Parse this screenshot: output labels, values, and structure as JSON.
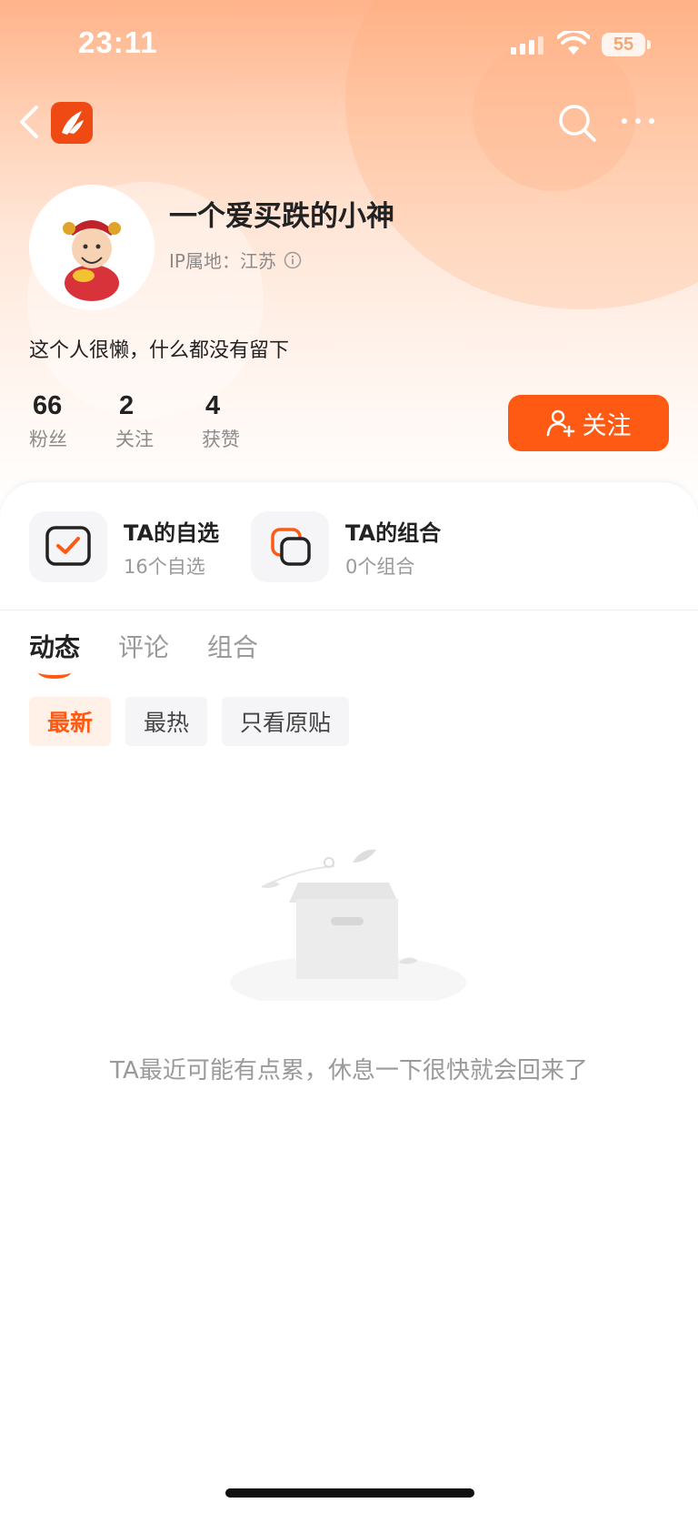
{
  "status_bar": {
    "time": "23:11",
    "battery": "55"
  },
  "profile": {
    "name": "一个爱买跌的小神",
    "ip_label": "IP属地：江苏",
    "bio": "这个人很懒，什么都没有留下",
    "stats": [
      {
        "value": "66",
        "label": "粉丝"
      },
      {
        "value": "2",
        "label": "关注"
      },
      {
        "value": "4",
        "label": "获赞"
      }
    ],
    "follow_label": "关注"
  },
  "portfolio": [
    {
      "title": "TA的自选",
      "sub": "16个自选"
    },
    {
      "title": "TA的组合",
      "sub": "0个组合"
    }
  ],
  "tabs": [
    "动态",
    "评论",
    "组合"
  ],
  "filters": [
    "最新",
    "最热",
    "只看原贴"
  ],
  "empty_message": "TA最近可能有点累，休息一下很快就会回来了",
  "colors": {
    "accent": "#ff5a14",
    "chip_active_bg": "#fff1e8"
  }
}
